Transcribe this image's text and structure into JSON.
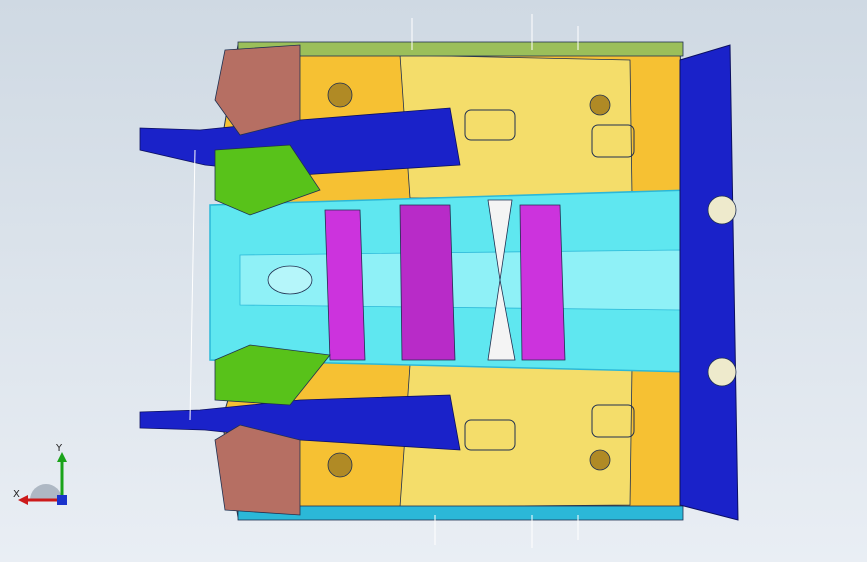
{
  "viewport": {
    "background": [
      "#cfd9e3",
      "#e9eef4"
    ]
  },
  "colors": {
    "floor_front": "#f6c133",
    "floor_mid": "#f4dd6a",
    "tunnel": "#5fe7f0",
    "tunnel_edge": "#2bb8d8",
    "bracket": "#cc33dd",
    "rail_blue": "#1a22c9",
    "rail_green": "#58c21a",
    "cowl": "#b66f63",
    "edge_olive": "#9bbf5a",
    "crossbar": "#f4f4f4",
    "outline": "#203050"
  },
  "triad": {
    "y_label": "Y",
    "x_label": "X"
  }
}
